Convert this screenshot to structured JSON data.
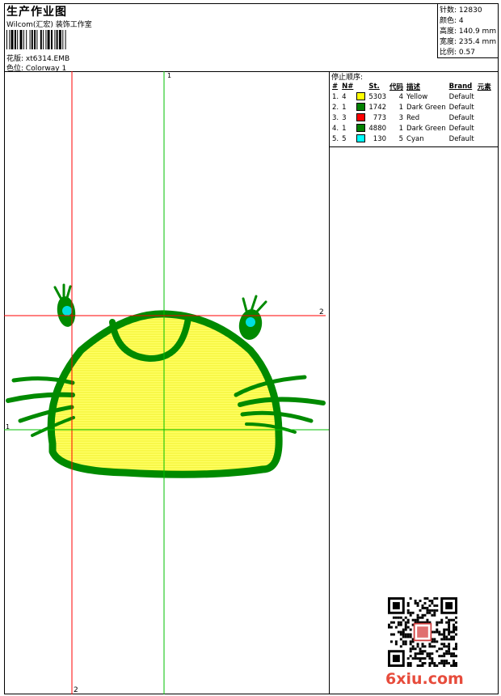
{
  "header": {
    "title": "生产作业图",
    "company": "Wilcom(汇宏) 装饰工作室",
    "pattern_label": "花版:",
    "pattern_value": "xt6314.EMB",
    "colorway_label": "色位:",
    "colorway_value": "Colorway 1"
  },
  "stats": {
    "stitches_label": "针数:",
    "stitches_value": "12830",
    "colors_label": "颜色:",
    "colors_value": "4",
    "height_label": "高度:",
    "height_value": "140.9 mm",
    "width_label": "宽度:",
    "width_value": "235.4 mm",
    "scale_label": "比例:",
    "scale_value": "0.57"
  },
  "stop_sequence": {
    "title": "停止顺序:",
    "headers": [
      "#",
      "N#",
      "St.",
      "代码",
      "描述",
      "Brand",
      "元素"
    ],
    "rows": [
      {
        "idx": "1.",
        "n": "4",
        "color": "#ffff00",
        "st": "5303",
        "code": "4",
        "desc": "Yellow",
        "brand": "Default"
      },
      {
        "idx": "2.",
        "n": "1",
        "color": "#008000",
        "st": "1742",
        "code": "1",
        "desc": "Dark Green",
        "brand": "Default"
      },
      {
        "idx": "3.",
        "n": "3",
        "color": "#ff0000",
        "st": "773",
        "code": "3",
        "desc": "Red",
        "brand": "Default"
      },
      {
        "idx": "4.",
        "n": "1",
        "color": "#008000",
        "st": "4880",
        "code": "1",
        "desc": "Dark Green",
        "brand": "Default"
      },
      {
        "idx": "5.",
        "n": "5",
        "color": "#00ffff",
        "st": "130",
        "code": "5",
        "desc": "Cyan",
        "brand": "Default"
      }
    ]
  },
  "guides": {
    "top_label": "1",
    "right_label": "2",
    "left_label": "1",
    "bottom_label": "2"
  },
  "colors": {
    "guide_red": "#ff0000",
    "guide_green": "#00c000",
    "fill_yellow": "#ffff66",
    "outline_green": "#008a00",
    "eye_cyan": "#00e0e0"
  },
  "watermark": {
    "logo_text": "6xiu.com"
  }
}
